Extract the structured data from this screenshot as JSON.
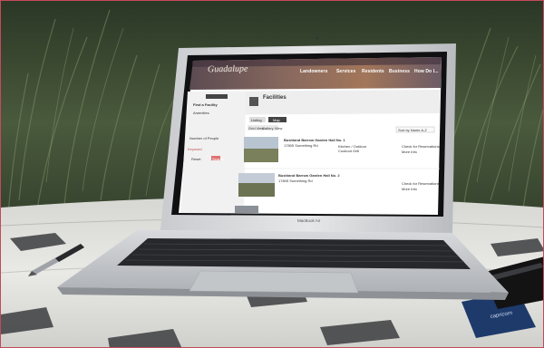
{
  "photo": {
    "scene": "laptop-on-stone-table",
    "colors": {
      "foliage_dark": "#1f2a1c",
      "foliage_light": "#59684a",
      "table": "#e6e6e3",
      "laptop_silver": "#cfd1d4",
      "keyboard": "#222326",
      "frame_border": "#c44a5a"
    }
  },
  "laptop": {
    "brand_label": "MacBook Air"
  },
  "site": {
    "logo": "Guadalupe",
    "nav": [
      "Landowners",
      "Services",
      "Residents",
      "Business",
      "How Do I..."
    ],
    "page_title": "Facilities",
    "search_button": "",
    "tabs": [
      "Listing",
      "Map"
    ],
    "view_buttons": [
      "Grid View",
      "Gallery View"
    ],
    "sort": "Sort by Name A-Z",
    "sidebar": {
      "labels": [
        "Find a Facility",
        "Amenities",
        "Number of People",
        "Keyword"
      ],
      "button_reset": "Reset",
      "button_search": "Search"
    },
    "listings": [
      {
        "name": "Bushland Barrow Garden Hall No. 1",
        "address": "17805 Something Rd",
        "features": [
          "Kitchen / Outdoor",
          "Cookout Grill"
        ],
        "links": [
          "Check for Reservations",
          "More Info"
        ]
      },
      {
        "name": "Bushland Barrow Garden Hall No. 2",
        "address": "17805 Something Rd",
        "features": [],
        "links": [
          "Check for Reservations",
          "More Info"
        ]
      }
    ]
  }
}
